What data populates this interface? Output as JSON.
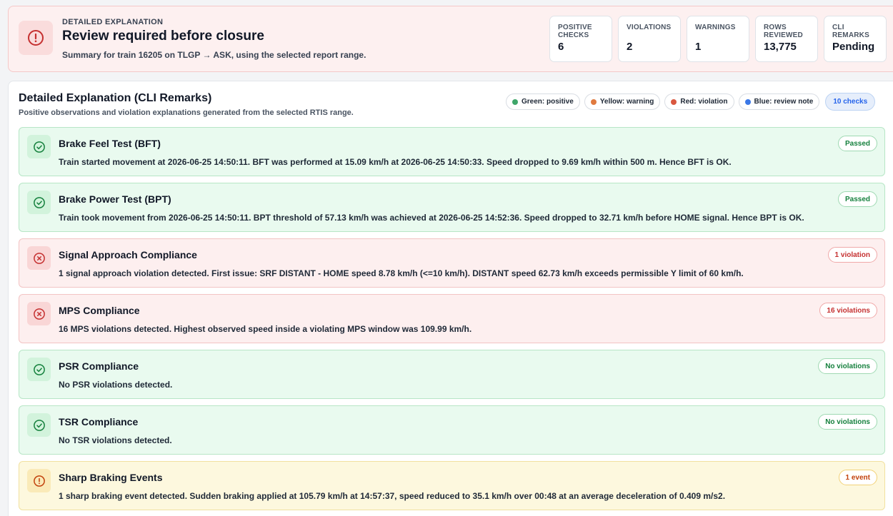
{
  "summary": {
    "kicker": "DETAILED EXPLANATION",
    "title": "Review required before closure",
    "subtitle": "Summary for train 16205 on TLGP → ASK, using the selected report range.",
    "icon": "alert-circle-icon",
    "accent_color": "#c53030",
    "stats": [
      {
        "label": "POSITIVE CHECKS",
        "value": "6"
      },
      {
        "label": "VIOLATIONS",
        "value": "2"
      },
      {
        "label": "WARNINGS",
        "value": "1"
      },
      {
        "label": "ROWS REVIEWED",
        "value": "13,775"
      },
      {
        "label": "CLI REMARKS",
        "value": "Pending"
      }
    ]
  },
  "panel": {
    "title": "Detailed Explanation (CLI Remarks)",
    "subtitle": "Positive observations and violation explanations generated from the selected RTIS range.",
    "legend": [
      {
        "label": "Green: positive",
        "color": "#3fa66a"
      },
      {
        "label": "Yellow: warning",
        "color": "#e07a3f"
      },
      {
        "label": "Red: violation",
        "color": "#d9573f"
      },
      {
        "label": "Blue: review note",
        "color": "#3b78e7"
      }
    ],
    "count_label": "10 checks"
  },
  "checks": [
    {
      "status": "green",
      "icon": "check-circle-icon",
      "title": "Brake Feel Test (BFT)",
      "description": "Train started movement at 2026-06-25 14:50:11. BFT was performed at 15.09 km/h at 2026-06-25 14:50:33. Speed dropped to 9.69 km/h within 500 m. Hence BFT is OK.",
      "badge": "Passed"
    },
    {
      "status": "green",
      "icon": "check-circle-icon",
      "title": "Brake Power Test (BPT)",
      "description": "Train took movement from 2026-06-25 14:50:11. BPT threshold of 57.13 km/h was achieved at 2026-06-25 14:52:36. Speed dropped to 32.71 km/h before HOME signal. Hence BPT is OK.",
      "badge": "Passed"
    },
    {
      "status": "red",
      "icon": "x-circle-icon",
      "title": "Signal Approach Compliance",
      "description": "1 signal approach violation detected. First issue: SRF DISTANT - HOME speed 8.78 km/h (<=10 km/h). DISTANT speed 62.73 km/h exceeds permissible Y limit of 60 km/h.",
      "badge": "1 violation"
    },
    {
      "status": "red",
      "icon": "x-circle-icon",
      "title": "MPS Compliance",
      "description": "16 MPS violations detected. Highest observed speed inside a violating MPS window was 109.99 km/h.",
      "badge": "16 violations"
    },
    {
      "status": "green",
      "icon": "check-circle-icon",
      "title": "PSR Compliance",
      "description": "No PSR violations detected.",
      "badge": "No violations"
    },
    {
      "status": "green",
      "icon": "check-circle-icon",
      "title": "TSR Compliance",
      "description": "No TSR violations detected.",
      "badge": "No violations"
    },
    {
      "status": "yellow",
      "icon": "alert-circle-icon",
      "title": "Sharp Braking Events",
      "description": "1 sharp braking event detected. Sudden braking applied at 105.79 km/h at 14:57:37, speed reduced to 35.1 km/h over 00:48 at an average deceleration of 0.409 m/s2.",
      "badge": "1 event"
    }
  ]
}
